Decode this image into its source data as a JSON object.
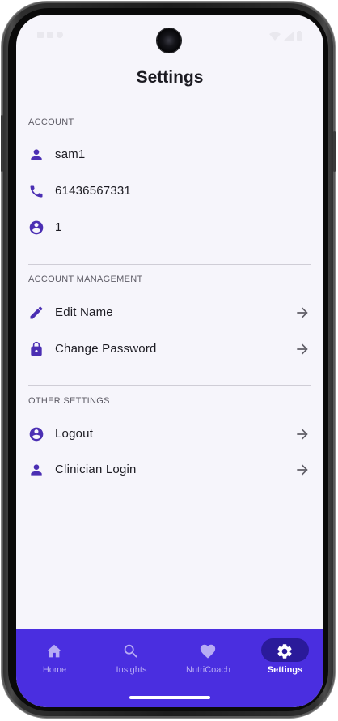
{
  "header": {
    "title": "Settings"
  },
  "sections": {
    "account": {
      "label": "ACCOUNT",
      "username": "sam1",
      "phone": "61436567331",
      "user_id": "1"
    },
    "account_management": {
      "label": "ACCOUNT MANAGEMENT",
      "edit_name": "Edit Name",
      "change_password": "Change Password"
    },
    "other_settings": {
      "label": "OTHER SETTINGS",
      "logout": "Logout",
      "clinician_login": "Clinician Login"
    }
  },
  "nav": {
    "home": "Home",
    "insights": "Insights",
    "nutricoach": "NutriCoach",
    "settings": "Settings",
    "active": "settings"
  },
  "colors": {
    "accent": "#4a2ee0",
    "icon": "#4b2fb3",
    "active_pill": "#2a1a9a",
    "background": "#f6f5fb"
  },
  "icons": {
    "username": "person-icon",
    "phone": "phone-icon",
    "user_id": "account-circle-icon",
    "edit_name": "pencil-icon",
    "change_password": "lock-icon",
    "logout": "account-circle-icon",
    "clinician_login": "person-icon",
    "row_arrow": "arrow-right-icon",
    "nav_home": "home-icon",
    "nav_insights": "search-icon",
    "nav_nutricoach": "heart-icon",
    "nav_settings": "gear-icon"
  }
}
